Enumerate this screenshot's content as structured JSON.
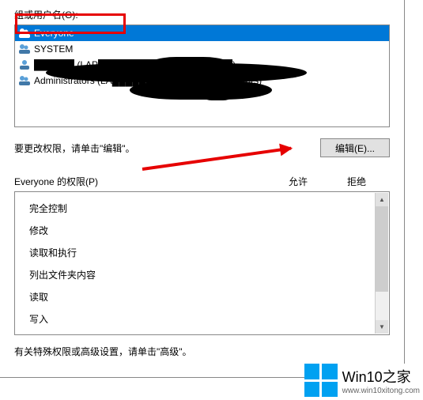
{
  "labels": {
    "groups_label": "组或用户名(G):",
    "edit_hint": "要更改权限，请单击\"编辑\"。",
    "edit_button": "编辑(E)...",
    "perms_for_prefix": "Everyone 的权限(P)",
    "allow": "允许",
    "deny": "拒绝",
    "footer": "有关特殊权限或高级设置，请单击\"高级\"。"
  },
  "groups": [
    {
      "name": "Everyone",
      "selected": true,
      "redacted": false
    },
    {
      "name": "SYSTEM",
      "selected": false,
      "redacted": false
    },
    {
      "name": "██████ (LAP████████████████████)",
      "selected": false,
      "redacted": true
    },
    {
      "name": "Administrators (LA████████████████nistrators)",
      "selected": false,
      "redacted": true
    }
  ],
  "permissions": [
    "完全控制",
    "修改",
    "读取和执行",
    "列出文件夹内容",
    "读取",
    "写入"
  ],
  "watermark": {
    "title": "Win10之家",
    "url": "www.win10xitong.com"
  }
}
